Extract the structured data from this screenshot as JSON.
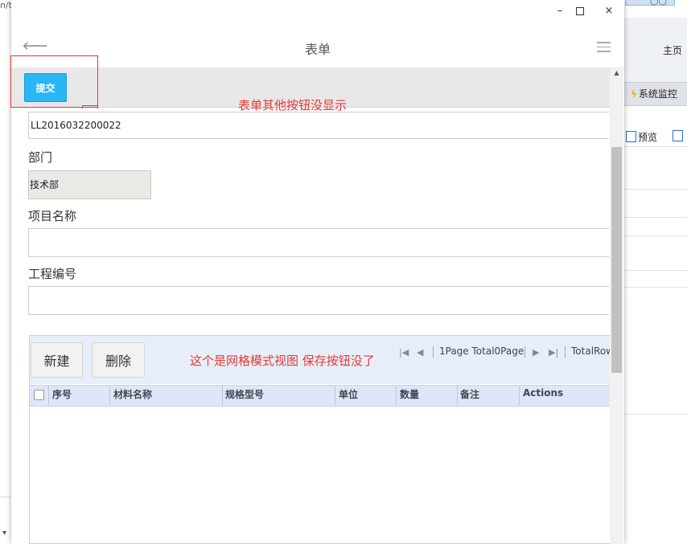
{
  "background": {
    "url_fragment": "n/t",
    "right_tab_text": "○○",
    "home_label": "主页",
    "monitor_label": "系统监控",
    "preview_label": "预览"
  },
  "window": {
    "min": "–",
    "close": "×"
  },
  "header": {
    "title": "表单"
  },
  "toolbar": {
    "submit_label": "提交"
  },
  "annotations": {
    "note1": "表单其他按钮没显示",
    "note2": "这个是网格模式视图 保存按钮没了"
  },
  "form": {
    "code_value": "LL2016032200022",
    "dept_label": "部门",
    "dept_value": "技术部",
    "project_label": "项目名称",
    "project_value": "",
    "engineering_label": "工程编号",
    "engineering_value": ""
  },
  "grid": {
    "new_label": "新建",
    "delete_label": "删除",
    "page_info": "1Page Total0Page",
    "total_rows": "TotalRow",
    "columns": [
      "序号",
      "材料名称",
      "规格型号",
      "单位",
      "数量",
      "备注",
      "Actions"
    ],
    "rows": []
  },
  "colors": {
    "accent": "#29b6f6",
    "annotation": "#e53935",
    "grid_header": "#dde7f7"
  }
}
